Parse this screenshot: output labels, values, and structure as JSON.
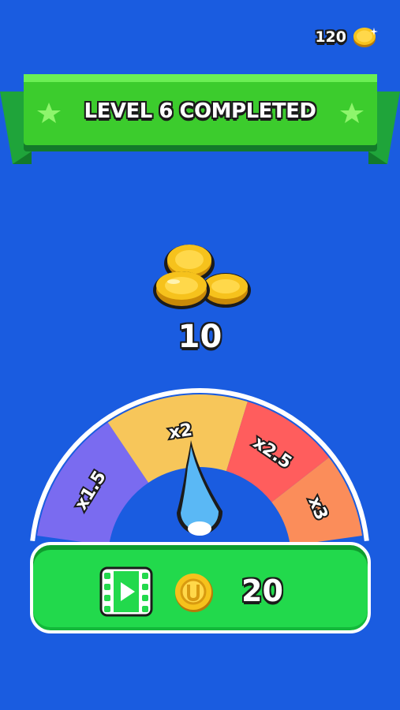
{
  "header": {
    "coin_balance": "120",
    "coin_icon": "gold-coin-icon"
  },
  "banner": {
    "title": "LEVEL 6 COMPLETED",
    "star_icon": "star-icon"
  },
  "reward": {
    "amount": "10",
    "icon": "coin-pile-icon"
  },
  "multiplier_wheel": {
    "segments": [
      {
        "label": "x1.5",
        "color": "#7a6bf0"
      },
      {
        "label": "x2",
        "color": "#f7c65a"
      },
      {
        "label": "x2.5",
        "color": "#ff5d5d"
      },
      {
        "label": "x3",
        "color": "#fb8d5a"
      }
    ],
    "selected": "x2"
  },
  "claim_button": {
    "amount": "20",
    "video_icon": "video-play-icon",
    "coin_icon": "gold-coin-icon",
    "color": "#22d94c"
  },
  "colors": {
    "background": "#1a5ce0",
    "banner_green": "#3ccc2d",
    "needle": "#5ab8f5"
  }
}
